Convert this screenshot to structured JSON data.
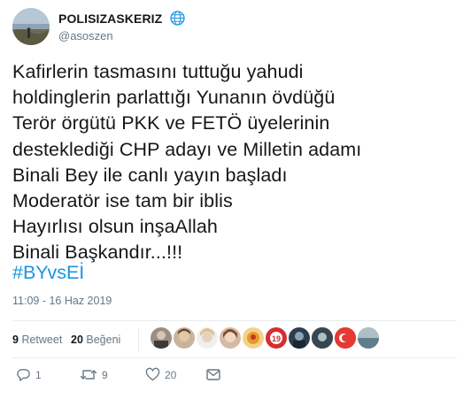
{
  "user": {
    "display_name": "POLISIZASKERIZ",
    "handle": "@asoszen",
    "verified_icon": "globe-icon",
    "avatar_icon": "landscape-avatar"
  },
  "tweet": {
    "text": "Kafirlerin tasmasını tuttuğu yahudi\nholdinglerin parlattığı Yunanın övdüğü\nTerör örgütü PKK ve FETÖ üyelerinin\ndesteklediği CHP adayı ve Milletin adamı\nBinali Bey ile canlı yayın başladı\nModeratör ise tam bir iblis\nHayırlısı olsun inşaAllah\nBinali Başkandır...!!!",
    "hashtag": "#BYvsEİ",
    "timestamp": "11:09 - 16 Haz 2019"
  },
  "stats": {
    "retweets_count": "9",
    "retweets_label": "Retweet",
    "likes_count": "20",
    "likes_label": "Beğeni"
  },
  "actions": {
    "reply_count": "1",
    "retweet_count": "9",
    "like_count": "20"
  },
  "colors": {
    "hashtag": "#1b95e0",
    "muted": "#657786",
    "divider": "#e6ecf0"
  }
}
